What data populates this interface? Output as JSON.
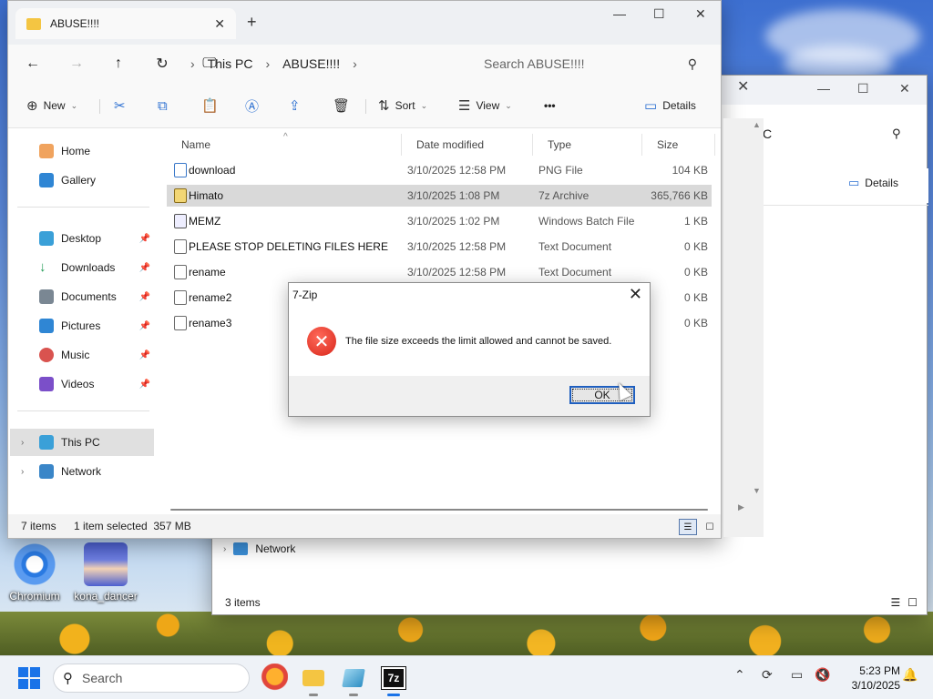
{
  "desktop": {
    "icons": [
      {
        "label": "Chromium",
        "icon": "chromium-icon"
      },
      {
        "label": "kona_dancer",
        "icon": "anime-character-icon"
      }
    ]
  },
  "back_window": {
    "search_fragment": "C",
    "details_label": "Details",
    "nav_network": "Network",
    "status_items": "3 items"
  },
  "explorer": {
    "tab_title": "ABUSE!!!!",
    "breadcrumbs": [
      "This PC",
      "ABUSE!!!!"
    ],
    "search_placeholder": "Search ABUSE!!!!",
    "commands": {
      "new": "New",
      "sort": "Sort",
      "view": "View",
      "more": "•••",
      "details": "Details"
    },
    "nav": {
      "home": "Home",
      "gallery": "Gallery",
      "desktop": "Desktop",
      "downloads": "Downloads",
      "documents": "Documents",
      "pictures": "Pictures",
      "music": "Music",
      "videos": "Videos",
      "this_pc": "This PC",
      "network": "Network"
    },
    "columns": {
      "name": "Name",
      "date": "Date modified",
      "type": "Type",
      "size": "Size"
    },
    "files": [
      {
        "name": "download",
        "date": "3/10/2025 12:58 PM",
        "type": "PNG File",
        "size": "104 KB",
        "kind": "png"
      },
      {
        "name": "Himato",
        "date": "3/10/2025 1:08 PM",
        "type": "7z Archive",
        "size": "365,766 KB",
        "kind": "zip"
      },
      {
        "name": "MEMZ",
        "date": "3/10/2025 1:02 PM",
        "type": "Windows Batch File",
        "size": "1 KB",
        "kind": "bat"
      },
      {
        "name": "PLEASE STOP DELETING FILES HERE",
        "date": "3/10/2025 12:58 PM",
        "type": "Text Document",
        "size": "0 KB",
        "kind": "txt"
      },
      {
        "name": "rename",
        "date": "3/10/2025 12:58 PM",
        "type": "Text Document",
        "size": "0 KB",
        "kind": "txt"
      },
      {
        "name": "rename2",
        "date": "",
        "type": "",
        "size": "0 KB",
        "kind": "txt"
      },
      {
        "name": "rename3",
        "date": "",
        "type": "",
        "size": "0 KB",
        "kind": "txt"
      }
    ],
    "status": {
      "count": "7 items",
      "selected": "1 item selected  357 MB"
    }
  },
  "dialog": {
    "title": "7-Zip",
    "message": "The file size exceeds the limit allowed and cannot be saved.",
    "ok_label": "OK",
    "icon": "error-icon"
  },
  "taskbar": {
    "search_label": "Search",
    "time": "5:23 PM",
    "date": "3/10/2025",
    "apps": [
      {
        "name": "firefox-icon"
      },
      {
        "name": "file-explorer-icon"
      },
      {
        "name": "notepad-icon"
      },
      {
        "name": "7zip-icon",
        "label": "7z"
      }
    ]
  },
  "colors": {
    "accent": "#1a73e8",
    "selection": "#d9d9d9",
    "error": "#d8261a"
  }
}
